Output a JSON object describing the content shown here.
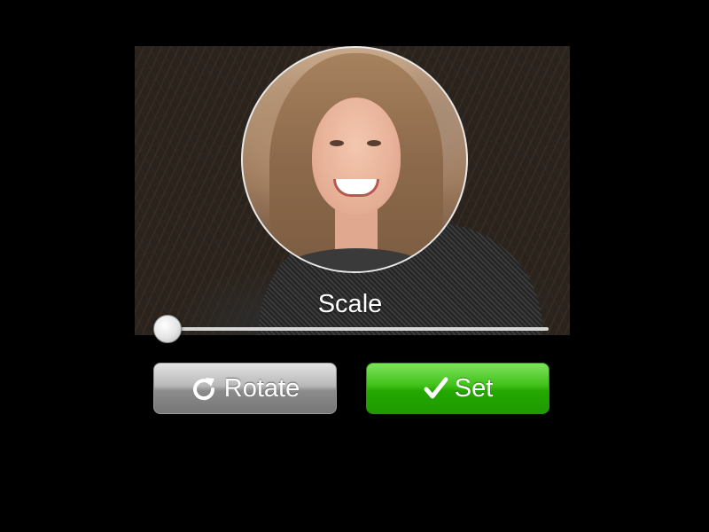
{
  "editor": {
    "scale_label": "Scale",
    "scale_value": 0
  },
  "buttons": {
    "rotate_label": "Rotate",
    "rotate_icon": "rotate-clockwise-icon",
    "set_label": "Set",
    "set_icon": "checkmark-icon"
  },
  "colors": {
    "background": "#000000",
    "set_button": "#2fb40a",
    "rotate_button": "#9a9a9a",
    "crop_ring": "#e8e8e8"
  }
}
